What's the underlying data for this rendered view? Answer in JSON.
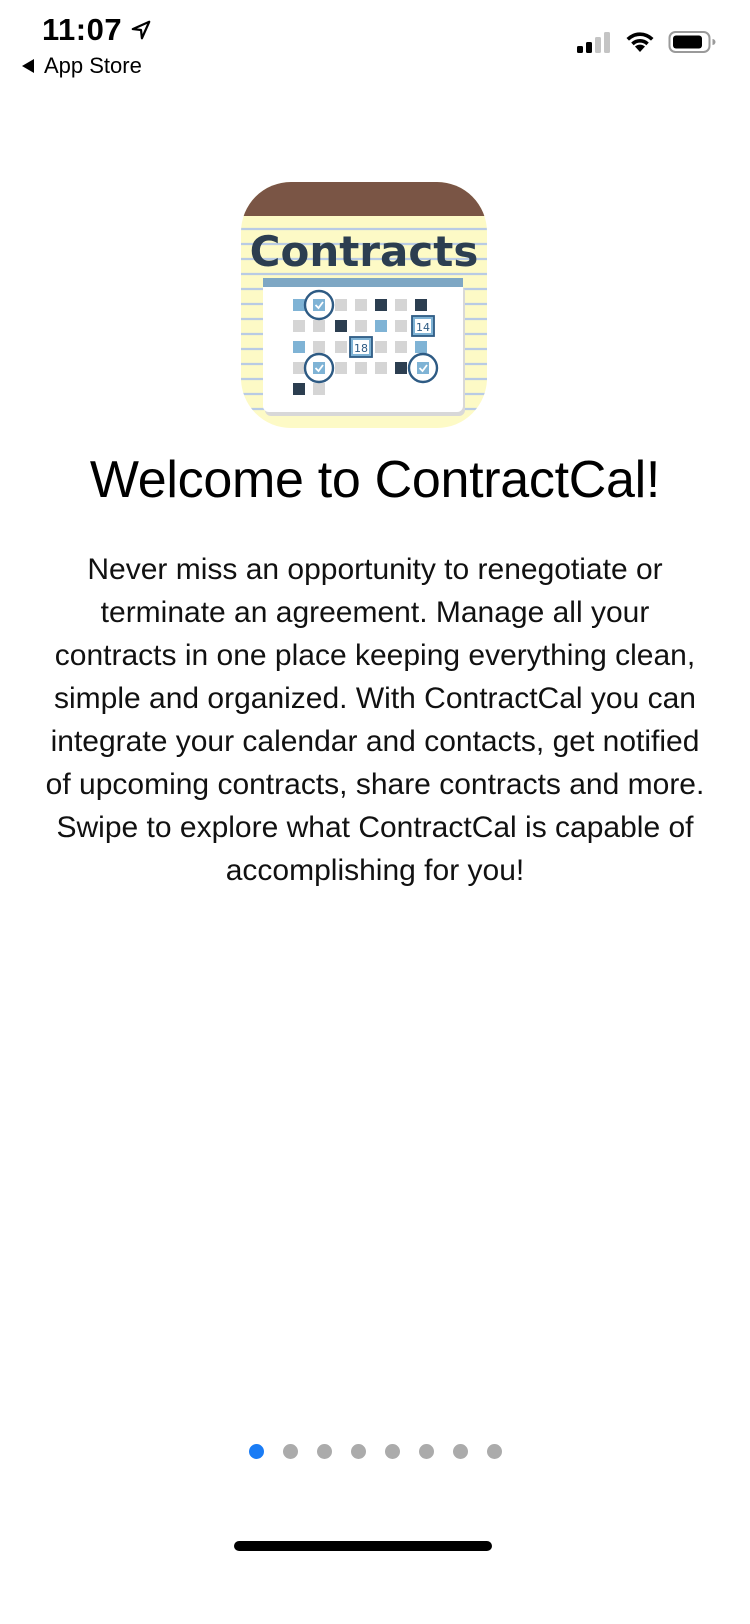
{
  "status_bar": {
    "time": "11:07",
    "back_label": "App Store",
    "icons": [
      "location-arrow-icon",
      "back-arrow-icon",
      "cellular-signal-icon",
      "wifi-icon",
      "battery-icon"
    ]
  },
  "app_icon": {
    "logo_text": "Contracts",
    "calendar_numbers": [
      "14",
      "18"
    ]
  },
  "welcome": {
    "title": "Welcome to ContractCal!",
    "body": "Never miss an opportunity to renegotiate or terminate an agreement. Manage all your contracts in one place keeping everything clean, simple and organized. With ContractCal you can integrate your calendar and contacts, get notified of upcoming contracts, share contracts and more. Swipe to explore what ContractCal is capable of accomplishing for you!"
  },
  "pagination": {
    "total_pages": 8,
    "current_page": 1
  },
  "colors": {
    "accent": "#1a7cf5",
    "inactive_dot": "#ababab",
    "icon_brown": "#7a5545",
    "icon_yellow": "#fdfac6",
    "icon_navy": "#2c3e50",
    "icon_blue": "#7fb3d5"
  }
}
